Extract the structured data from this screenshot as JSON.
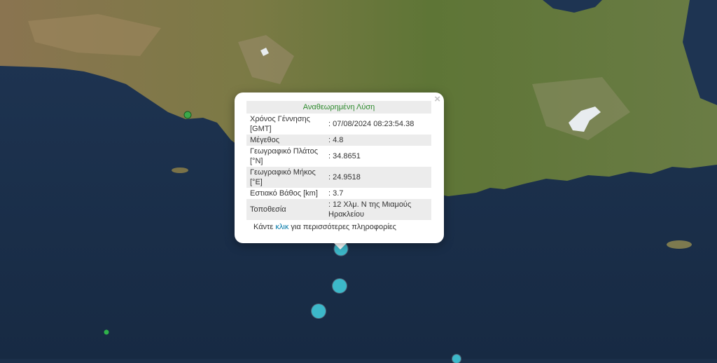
{
  "popup": {
    "title": "Αναθεωρημένη Λύση",
    "close_symbol": "×",
    "rows": [
      {
        "label": "Χρόνος Γέννησης [GMT]",
        "value": ": 07/08/2024 08:23:54.38"
      },
      {
        "label": "Μέγεθος",
        "value": ": 4.8"
      },
      {
        "label": "Γεωγραφικό Πλάτος [°N]",
        "value": ": 34.8651"
      },
      {
        "label": "Γεωγραφικό Μήκος [°E]",
        "value": ": 24.9518"
      },
      {
        "label": "Εστιακό Βάθος [km]",
        "value": ": 3.7"
      },
      {
        "label": "Τοποθεσία",
        "value": ": 12 Χλμ. Ν της Μιαμούς Ηρακλείου"
      }
    ],
    "footer_before": "Κάντε ",
    "footer_link": "κλικ",
    "footer_after": " για περισσότερες πληροφορίες"
  },
  "colors": {
    "sea": "#1b2f49",
    "land": "#6e7a3e",
    "quake_marker": "#3cb8c9",
    "small_marker": "#2fb24a",
    "title_green": "#2e8b2e"
  }
}
